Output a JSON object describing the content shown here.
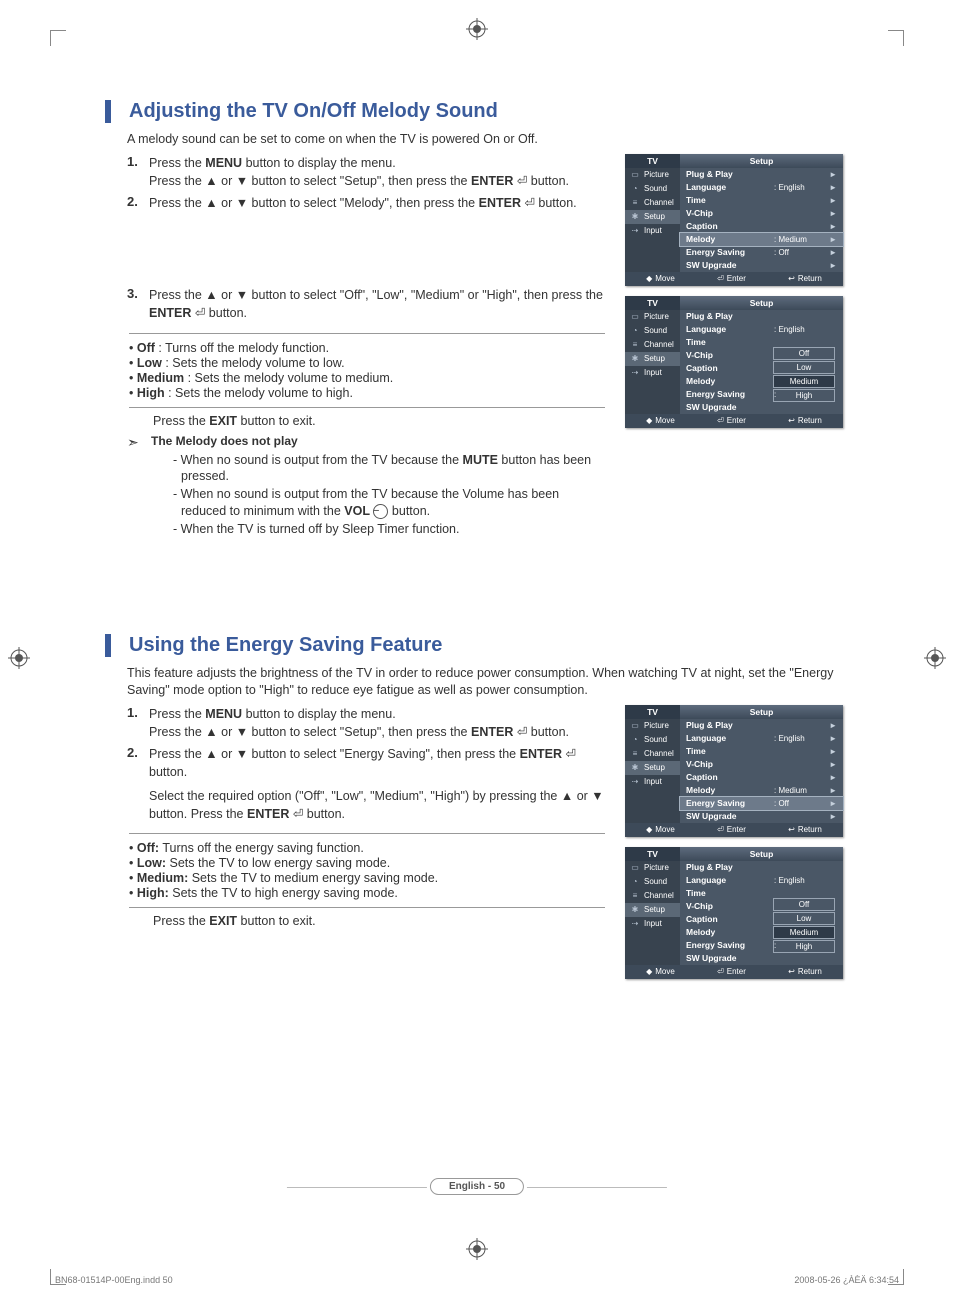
{
  "section1": {
    "title": "Adjusting the TV On/Off Melody Sound",
    "intro": "A melody sound can be set to come on when the TV is powered On or Off.",
    "steps": [
      {
        "num": "1.",
        "lines": [
          "Press the <b>MENU</b> button to display the menu.",
          "Press the ▲ or ▼ button to select \"Setup\", then press the <b>ENTER</b> ⏎ button."
        ]
      },
      {
        "num": "2.",
        "lines": [
          "Press the ▲ or ▼ button to select \"Melody\", then press the <b>ENTER</b> ⏎ button."
        ]
      },
      {
        "num": "3.",
        "lines": [
          "Press the ▲ or ▼ button to select \"Off\", \"Low\", \"Medium\" or \"High\", then press the <b>ENTER</b> ⏎ button."
        ]
      }
    ],
    "options": [
      "<b>Off</b> : Turns off the melody function.",
      "<b>Low</b> : Sets the melody volume to low.",
      "<b>Medium</b> : Sets the melody volume to medium.",
      "<b>High</b> : Sets the melody volume to high."
    ],
    "exit": "Press the <b>EXIT</b> button to exit.",
    "note_title": "The Melody does not play",
    "note_items": [
      "- When no sound is output from the TV because the <b>MUTE</b> button has been pressed.",
      "- When no sound is output from the TV because the Volume has been reduced to minimum with the <b>VOL</b> <span class=\"vol-circle\">−</span> button.",
      "- When the TV is turned off by Sleep Timer function."
    ]
  },
  "section2": {
    "title": "Using the Energy Saving Feature",
    "intro": "This feature adjusts the brightness of the TV in order to reduce power consumption. When watching TV at night, set the \"Energy Saving\" mode option to \"High\" to reduce eye fatigue as well as power consumption.",
    "steps": [
      {
        "num": "1.",
        "lines": [
          "Press the <b>MENU</b> button to display the menu.",
          "Press the ▲ or ▼ button to select \"Setup\", then press the <b>ENTER</b> ⏎ button."
        ]
      },
      {
        "num": "2.",
        "lines": [
          "Press the ▲ or ▼ button to select \"Energy Saving\", then press the <b>ENTER</b> ⏎ button.",
          "Select the required option (\"Off\", \"Low\", \"Medium\", \"High\") by pressing the ▲ or ▼ button. Press the <b>ENTER</b> ⏎ button."
        ]
      }
    ],
    "options": [
      "<b>Off:</b> Turns off the energy saving function.",
      "<b>Low:</b> Sets the TV to low energy saving mode.",
      "<b>Medium:</b> Sets the TV to medium energy saving mode.",
      "<b>High:</b> Sets the TV to high energy saving mode."
    ],
    "exit": "Press the <b>EXIT</b> button to exit."
  },
  "osd_common": {
    "tv": "TV",
    "setup": "Setup",
    "side": [
      "Picture",
      "Sound",
      "Channel",
      "Setup",
      "Input"
    ],
    "foot_move": "Move",
    "foot_enter": "Enter",
    "foot_return": "Return"
  },
  "osd1": {
    "rows": [
      {
        "lbl": "Plug & Play",
        "val": "",
        "arr": "►"
      },
      {
        "lbl": "Language",
        "val": ": English",
        "arr": "►"
      },
      {
        "lbl": "Time",
        "val": "",
        "arr": "►"
      },
      {
        "lbl": "V-Chip",
        "val": "",
        "arr": "►"
      },
      {
        "lbl": "Caption",
        "val": "",
        "arr": "►"
      },
      {
        "lbl": "Melody",
        "val": ": Medium",
        "arr": "►",
        "hl": true
      },
      {
        "lbl": "Energy Saving",
        "val": ": Off",
        "arr": "►"
      },
      {
        "lbl": "SW Upgrade",
        "val": "",
        "arr": "►"
      }
    ]
  },
  "osd2": {
    "rows": [
      {
        "lbl": "Plug & Play",
        "val": ""
      },
      {
        "lbl": "Language",
        "val": ": English"
      },
      {
        "lbl": "Time",
        "val": ""
      },
      {
        "lbl": "V-Chip",
        "val": ""
      },
      {
        "lbl": "Caption",
        "val": ""
      },
      {
        "lbl": "Melody",
        "val": ":"
      },
      {
        "lbl": "Energy Saving",
        "val": ":"
      },
      {
        "lbl": "SW Upgrade",
        "val": ""
      }
    ],
    "opts": [
      "Off",
      "Low",
      "Medium",
      "High"
    ],
    "sel": 2
  },
  "osd3": {
    "rows": [
      {
        "lbl": "Plug & Play",
        "val": "",
        "arr": "►"
      },
      {
        "lbl": "Language",
        "val": ": English",
        "arr": "►"
      },
      {
        "lbl": "Time",
        "val": "",
        "arr": "►"
      },
      {
        "lbl": "V-Chip",
        "val": "",
        "arr": "►"
      },
      {
        "lbl": "Caption",
        "val": "",
        "arr": "►"
      },
      {
        "lbl": "Melody",
        "val": ": Medium",
        "arr": "►"
      },
      {
        "lbl": "Energy Saving",
        "val": ": Off",
        "arr": "►",
        "hl": true
      },
      {
        "lbl": "SW Upgrade",
        "val": "",
        "arr": "►"
      }
    ]
  },
  "osd4": {
    "rows": [
      {
        "lbl": "Plug & Play",
        "val": ""
      },
      {
        "lbl": "Language",
        "val": ": English"
      },
      {
        "lbl": "Time",
        "val": ""
      },
      {
        "lbl": "V-Chip",
        "val": ""
      },
      {
        "lbl": "Caption",
        "val": ""
      },
      {
        "lbl": "Melody",
        "val": ":"
      },
      {
        "lbl": "Energy Saving",
        "val": ":"
      },
      {
        "lbl": "SW Upgrade",
        "val": ""
      }
    ],
    "opts": [
      "Off",
      "Low",
      "Medium",
      "High"
    ],
    "sel": 2
  },
  "page_num": "English - 50",
  "footer_left": "BN68-01514P-00Eng.indd   50",
  "footer_right": "2008-05-26   ¿ÀÈÄ 6:34:54"
}
